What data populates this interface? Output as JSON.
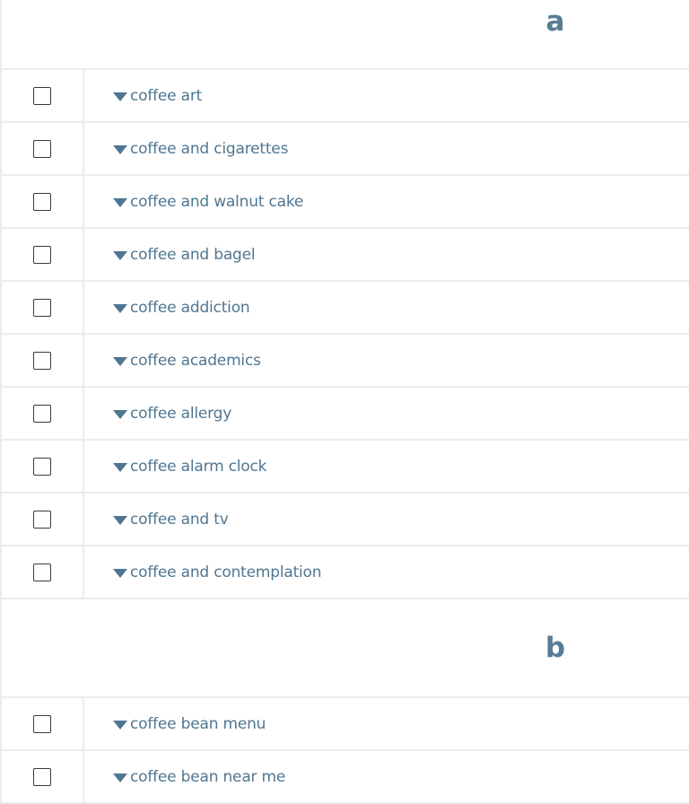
{
  "sections": [
    {
      "letter": "a",
      "items": [
        "coffee art",
        "coffee and cigarettes",
        "coffee and walnut cake",
        "coffee and bagel",
        "coffee addiction",
        "coffee academics",
        "coffee allergy",
        "coffee alarm clock",
        "coffee and tv",
        "coffee and contemplation"
      ]
    },
    {
      "letter": "b",
      "items": [
        "coffee bean menu",
        "coffee bean near me"
      ]
    }
  ],
  "icons": {
    "caret": "caret-down-icon",
    "checkbox": "checkbox-unchecked"
  },
  "colors": {
    "text": "#4f7691",
    "header": "#587c95",
    "divider": "#ececec"
  }
}
